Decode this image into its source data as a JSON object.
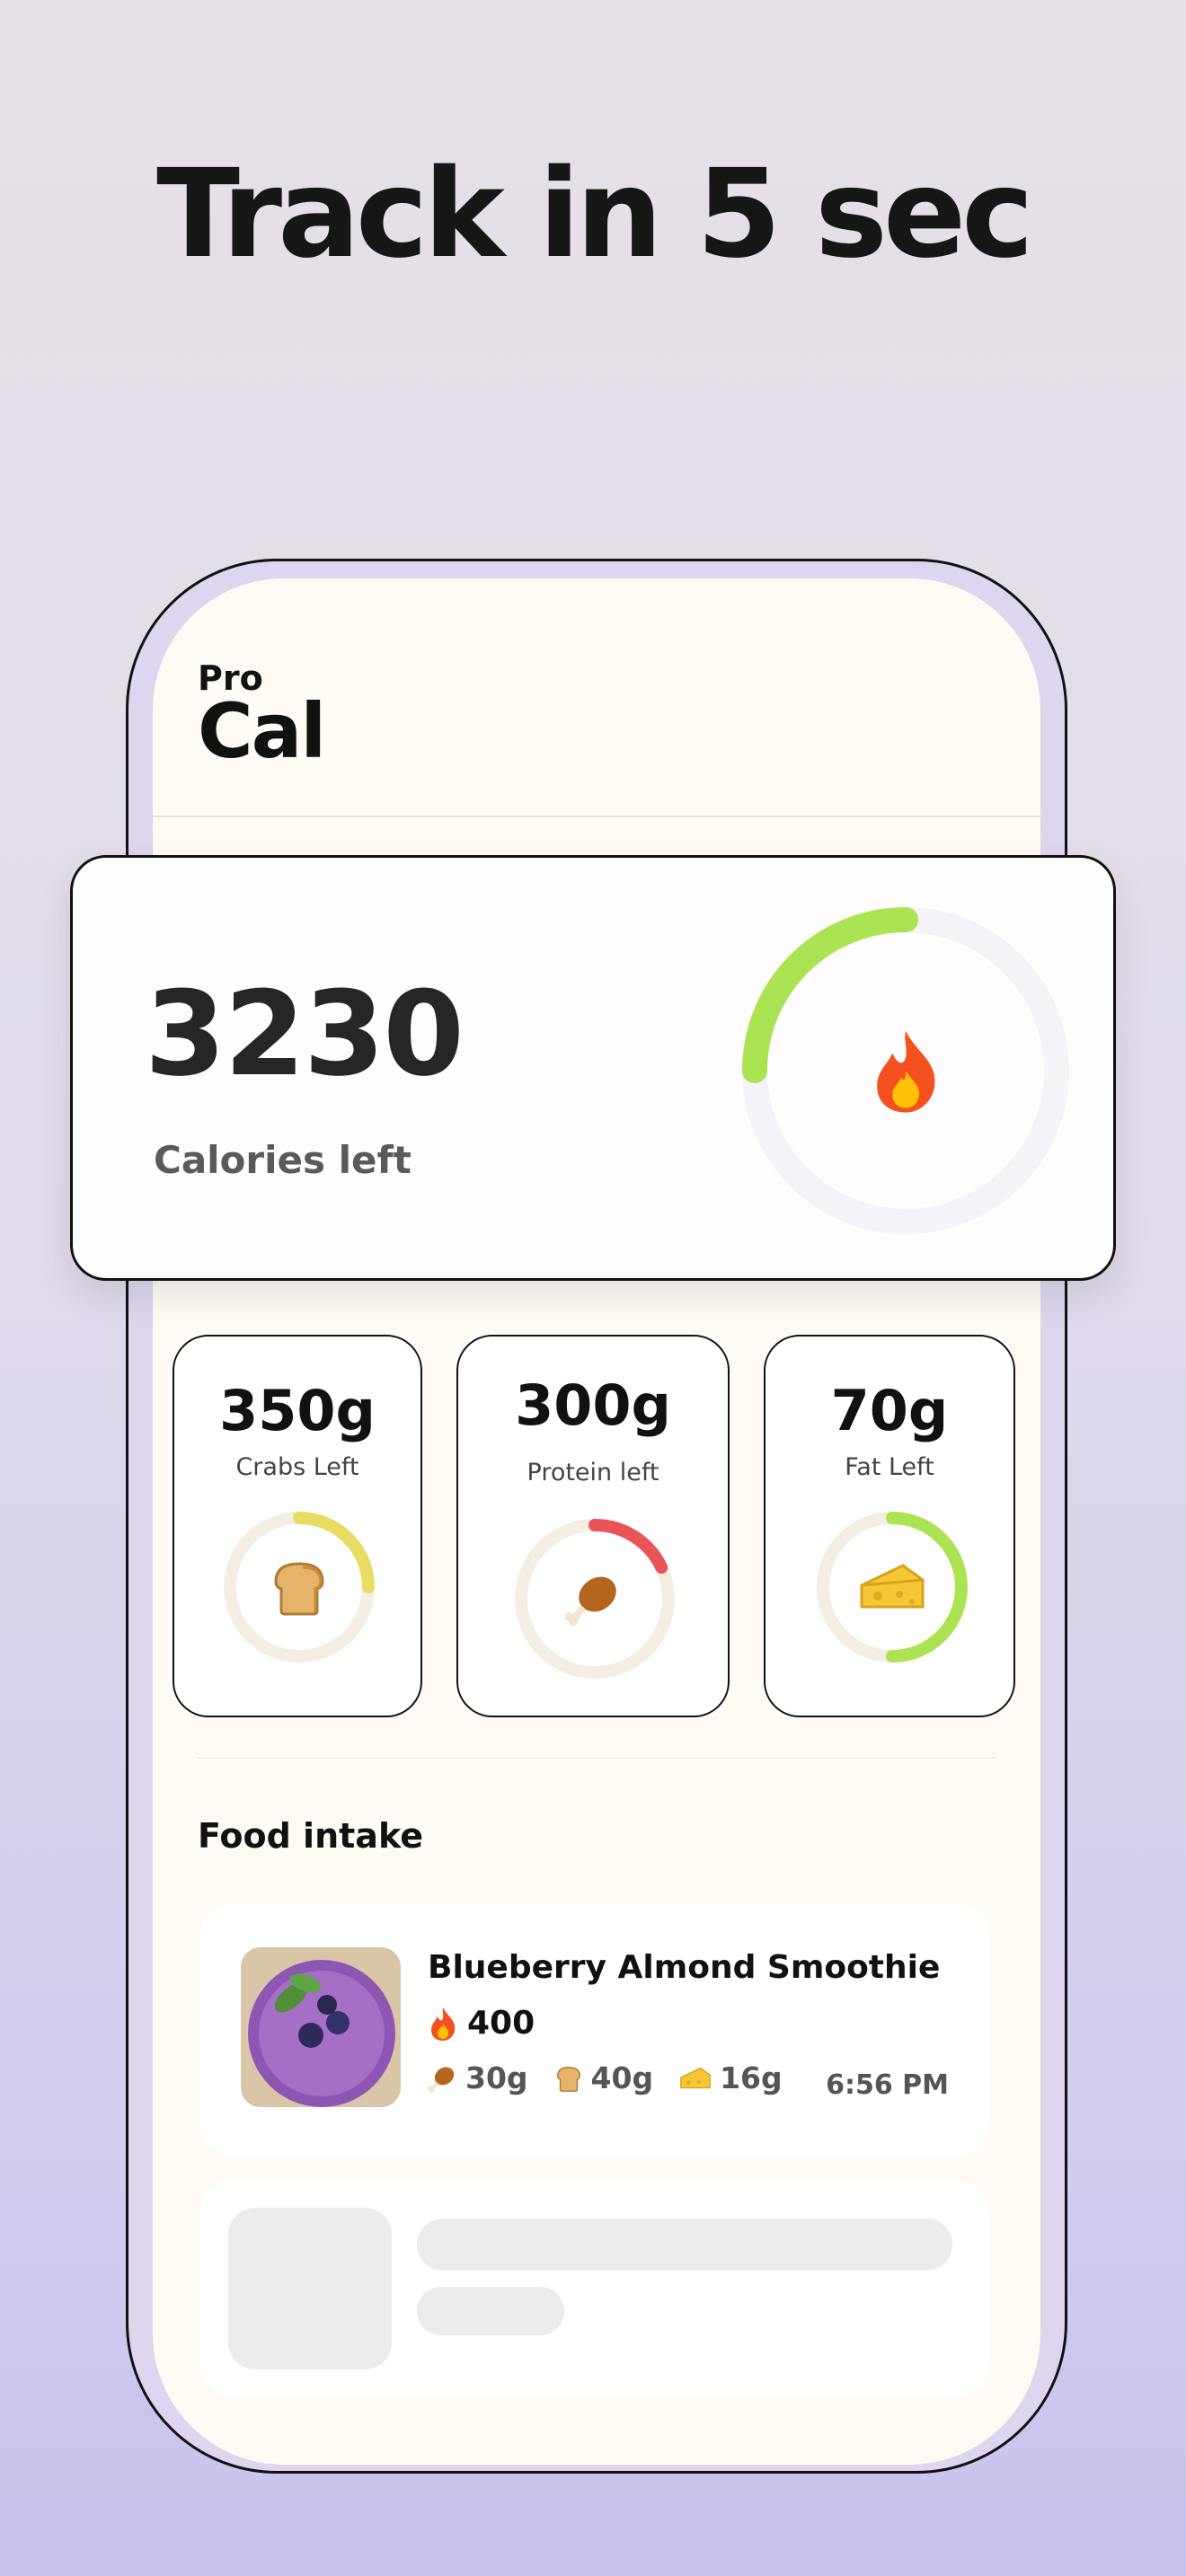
{
  "headline": "Track in 5 sec",
  "app": {
    "logo_small": "Pro",
    "logo_large": "Cal"
  },
  "calories": {
    "value": "3230",
    "label": "Calories left",
    "progress": 0.25,
    "icon": "fire-icon",
    "ring_color": "#abe353",
    "track_color": "#f4f3f7"
  },
  "macros": [
    {
      "value": "350g",
      "label": "Crabs Left",
      "icon": "bread-icon",
      "progress": 0.25,
      "color": "#e8dd63"
    },
    {
      "value": "300g",
      "label": "Protein left",
      "icon": "drumstick-icon",
      "progress": 0.18,
      "color": "#e85457"
    },
    {
      "value": "70g",
      "label": "Fat Left",
      "icon": "cheese-icon",
      "progress": 0.5,
      "color": "#abe353"
    }
  ],
  "food": {
    "section_title": "Food intake",
    "items": [
      {
        "name": "Blueberry Almond Smoothie",
        "calories": "400",
        "protein": "30g",
        "carbs": "40g",
        "fat": "16g",
        "time": "6:56 PM"
      }
    ]
  }
}
